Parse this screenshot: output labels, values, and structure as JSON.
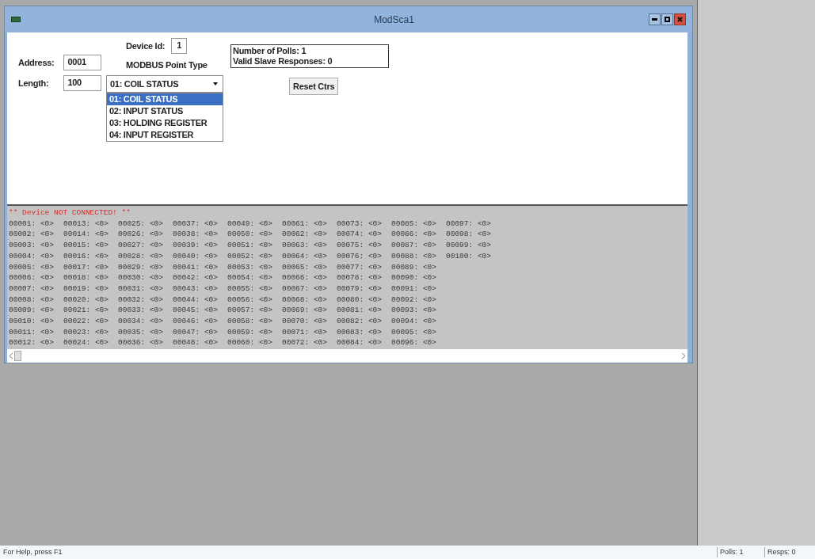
{
  "window": {
    "title": "ModSca1"
  },
  "form": {
    "address_label": "Address:",
    "address_value": "0001",
    "length_label": "Length:",
    "length_value": "100",
    "device_id_label": "Device Id:",
    "device_id_value": "1",
    "point_type_label": "MODBUS Point Type",
    "point_type_value": "01: COIL STATUS",
    "point_type_options": [
      {
        "label": "01: COIL STATUS",
        "selected": true
      },
      {
        "label": "02: INPUT STATUS",
        "selected": false
      },
      {
        "label": "03: HOLDING REGISTER",
        "selected": false
      },
      {
        "label": "04: INPUT REGISTER",
        "selected": false
      }
    ]
  },
  "counters": {
    "lines": [
      "Number of Polls: 1",
      "Valid Slave Responses: 0"
    ],
    "reset_button": "Reset Ctrs"
  },
  "data_view": {
    "header": "** Device NOT CONNECTED! **",
    "cells": [
      {
        "address": "00001:",
        "value": "<0>"
      },
      {
        "address": "00002:",
        "value": "<0>"
      },
      {
        "address": "00003:",
        "value": "<0>"
      },
      {
        "address": "00004:",
        "value": "<0>"
      },
      {
        "address": "00005:",
        "value": "<0>"
      },
      {
        "address": "00006:",
        "value": "<0>"
      },
      {
        "address": "00007:",
        "value": "<0>"
      },
      {
        "address": "00008:",
        "value": "<0>"
      },
      {
        "address": "00009:",
        "value": "<0>"
      },
      {
        "address": "00010:",
        "value": "<0>"
      },
      {
        "address": "00011:",
        "value": "<0>"
      },
      {
        "address": "00012:",
        "value": "<0>"
      },
      {
        "address": "00013:",
        "value": "<0>"
      },
      {
        "address": "00014:",
        "value": "<0>"
      },
      {
        "address": "00015:",
        "value": "<0>"
      },
      {
        "address": "00016:",
        "value": "<0>"
      },
      {
        "address": "00017:",
        "value": "<0>"
      },
      {
        "address": "00018:",
        "value": "<0>"
      },
      {
        "address": "00019:",
        "value": "<0>"
      },
      {
        "address": "00020:",
        "value": "<0>"
      },
      {
        "address": "00021:",
        "value": "<0>"
      },
      {
        "address": "00022:",
        "value": "<0>"
      },
      {
        "address": "00023:",
        "value": "<0>"
      },
      {
        "address": "00024:",
        "value": "<0>"
      },
      {
        "address": "00025:",
        "value": "<0>"
      },
      {
        "address": "00026:",
        "value": "<0>"
      },
      {
        "address": "00027:",
        "value": "<0>"
      },
      {
        "address": "00028:",
        "value": "<0>"
      },
      {
        "address": "00029:",
        "value": "<0>"
      },
      {
        "address": "00030:",
        "value": "<0>"
      },
      {
        "address": "00031:",
        "value": "<0>"
      },
      {
        "address": "00032:",
        "value": "<0>"
      },
      {
        "address": "00033:",
        "value": "<0>"
      },
      {
        "address": "00034:",
        "value": "<0>"
      },
      {
        "address": "00035:",
        "value": "<0>"
      },
      {
        "address": "00036:",
        "value": "<0>"
      },
      {
        "address": "00037:",
        "value": "<0>"
      },
      {
        "address": "00038:",
        "value": "<0>"
      },
      {
        "address": "00039:",
        "value": "<0>"
      },
      {
        "address": "00040:",
        "value": "<0>"
      },
      {
        "address": "00041:",
        "value": "<0>"
      },
      {
        "address": "00042:",
        "value": "<0>"
      },
      {
        "address": "00043:",
        "value": "<0>"
      },
      {
        "address": "00044:",
        "value": "<0>"
      },
      {
        "address": "00045:",
        "value": "<0>"
      },
      {
        "address": "00046:",
        "value": "<0>"
      },
      {
        "address": "00047:",
        "value": "<0>"
      },
      {
        "address": "00048:",
        "value": "<0>"
      },
      {
        "address": "00049:",
        "value": "<0>"
      },
      {
        "address": "00050:",
        "value": "<0>"
      },
      {
        "address": "00051:",
        "value": "<0>"
      },
      {
        "address": "00052:",
        "value": "<0>"
      },
      {
        "address": "00053:",
        "value": "<0>"
      },
      {
        "address": "00054:",
        "value": "<0>"
      },
      {
        "address": "00055:",
        "value": "<0>"
      },
      {
        "address": "00056:",
        "value": "<0>"
      },
      {
        "address": "00057:",
        "value": "<0>"
      },
      {
        "address": "00058:",
        "value": "<0>"
      },
      {
        "address": "00059:",
        "value": "<0>"
      },
      {
        "address": "00060:",
        "value": "<0>"
      },
      {
        "address": "00061:",
        "value": "<0>"
      },
      {
        "address": "00062:",
        "value": "<0>"
      },
      {
        "address": "00063:",
        "value": "<0>"
      },
      {
        "address": "00064:",
        "value": "<0>"
      },
      {
        "address": "00065:",
        "value": "<0>"
      },
      {
        "address": "00066:",
        "value": "<0>"
      },
      {
        "address": "00067:",
        "value": "<0>"
      },
      {
        "address": "00068:",
        "value": "<0>"
      },
      {
        "address": "00069:",
        "value": "<0>"
      },
      {
        "address": "00070:",
        "value": "<0>"
      },
      {
        "address": "00071:",
        "value": "<0>"
      },
      {
        "address": "00072:",
        "value": "<0>"
      },
      {
        "address": "00073:",
        "value": "<0>"
      },
      {
        "address": "00074:",
        "value": "<0>"
      },
      {
        "address": "00075:",
        "value": "<0>"
      },
      {
        "address": "00076:",
        "value": "<0>"
      },
      {
        "address": "00077:",
        "value": "<0>"
      },
      {
        "address": "00078:",
        "value": "<0>"
      },
      {
        "address": "00079:",
        "value": "<0>"
      },
      {
        "address": "00080:",
        "value": "<0>"
      },
      {
        "address": "00081:",
        "value": "<0>"
      },
      {
        "address": "00082:",
        "value": "<0>"
      },
      {
        "address": "00083:",
        "value": "<0>"
      },
      {
        "address": "00084:",
        "value": "<0>"
      },
      {
        "address": "00085:",
        "value": "<0>"
      },
      {
        "address": "00086:",
        "value": "<0>"
      },
      {
        "address": "00087:",
        "value": "<0>"
      },
      {
        "address": "00088:",
        "value": "<0>"
      },
      {
        "address": "00089:",
        "value": "<0>"
      },
      {
        "address": "00090:",
        "value": "<0>"
      },
      {
        "address": "00091:",
        "value": "<0>"
      },
      {
        "address": "00092:",
        "value": "<0>"
      },
      {
        "address": "00093:",
        "value": "<0>"
      },
      {
        "address": "00094:",
        "value": "<0>"
      },
      {
        "address": "00095:",
        "value": "<0>"
      },
      {
        "address": "00096:",
        "value": "<0>"
      },
      {
        "address": "00097:",
        "value": "<0>"
      },
      {
        "address": "00098:",
        "value": "<0>"
      },
      {
        "address": "00099:",
        "value": "<0>"
      },
      {
        "address": "00100:",
        "value": "<0>"
      }
    ]
  },
  "status_bar": {
    "help": "For Help, press F1",
    "panes": [
      "Polls: 1",
      "Resps: 0"
    ]
  }
}
